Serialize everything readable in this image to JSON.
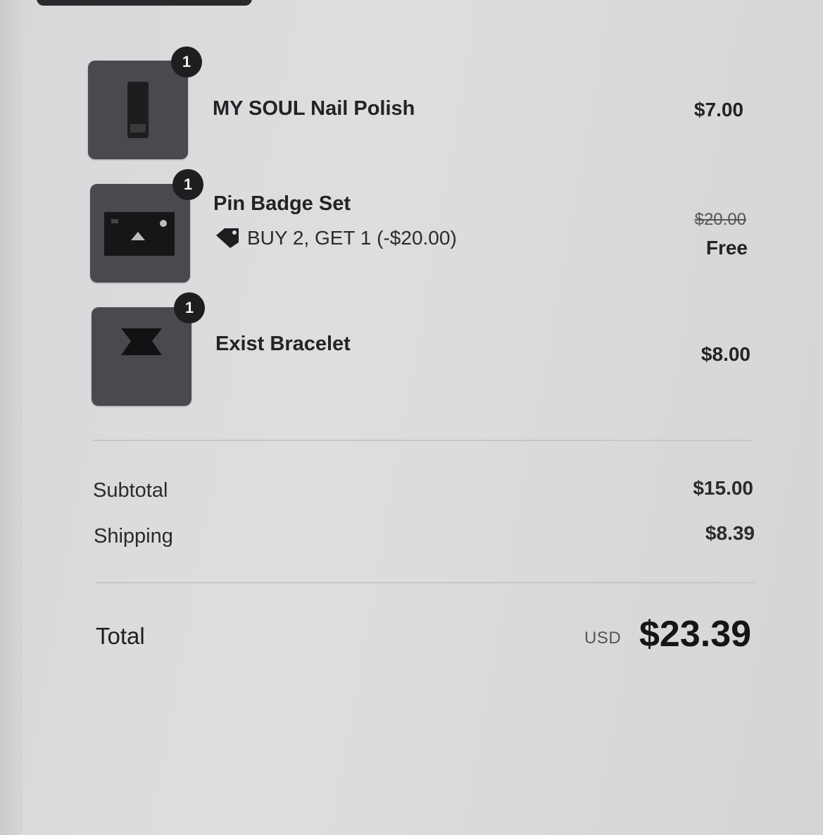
{
  "items": [
    {
      "name": "MY SOUL Nail Polish",
      "quantity": "1",
      "price": "$7.00",
      "image_icon": "nail-polish-image"
    },
    {
      "name": "Pin Badge Set",
      "quantity": "1",
      "original_price": "$20.00",
      "price": "Free",
      "discount": "BUY 2, GET 1 (-$20.00)",
      "image_icon": "pin-badge-image"
    },
    {
      "name": "Exist Bracelet",
      "quantity": "1",
      "price": "$8.00",
      "image_icon": "bracelet-image"
    }
  ],
  "summary": {
    "subtotal_label": "Subtotal",
    "subtotal_value": "$15.00",
    "shipping_label": "Shipping",
    "shipping_value": "$8.39"
  },
  "total": {
    "label": "Total",
    "currency": "USD",
    "value": "$23.39"
  }
}
